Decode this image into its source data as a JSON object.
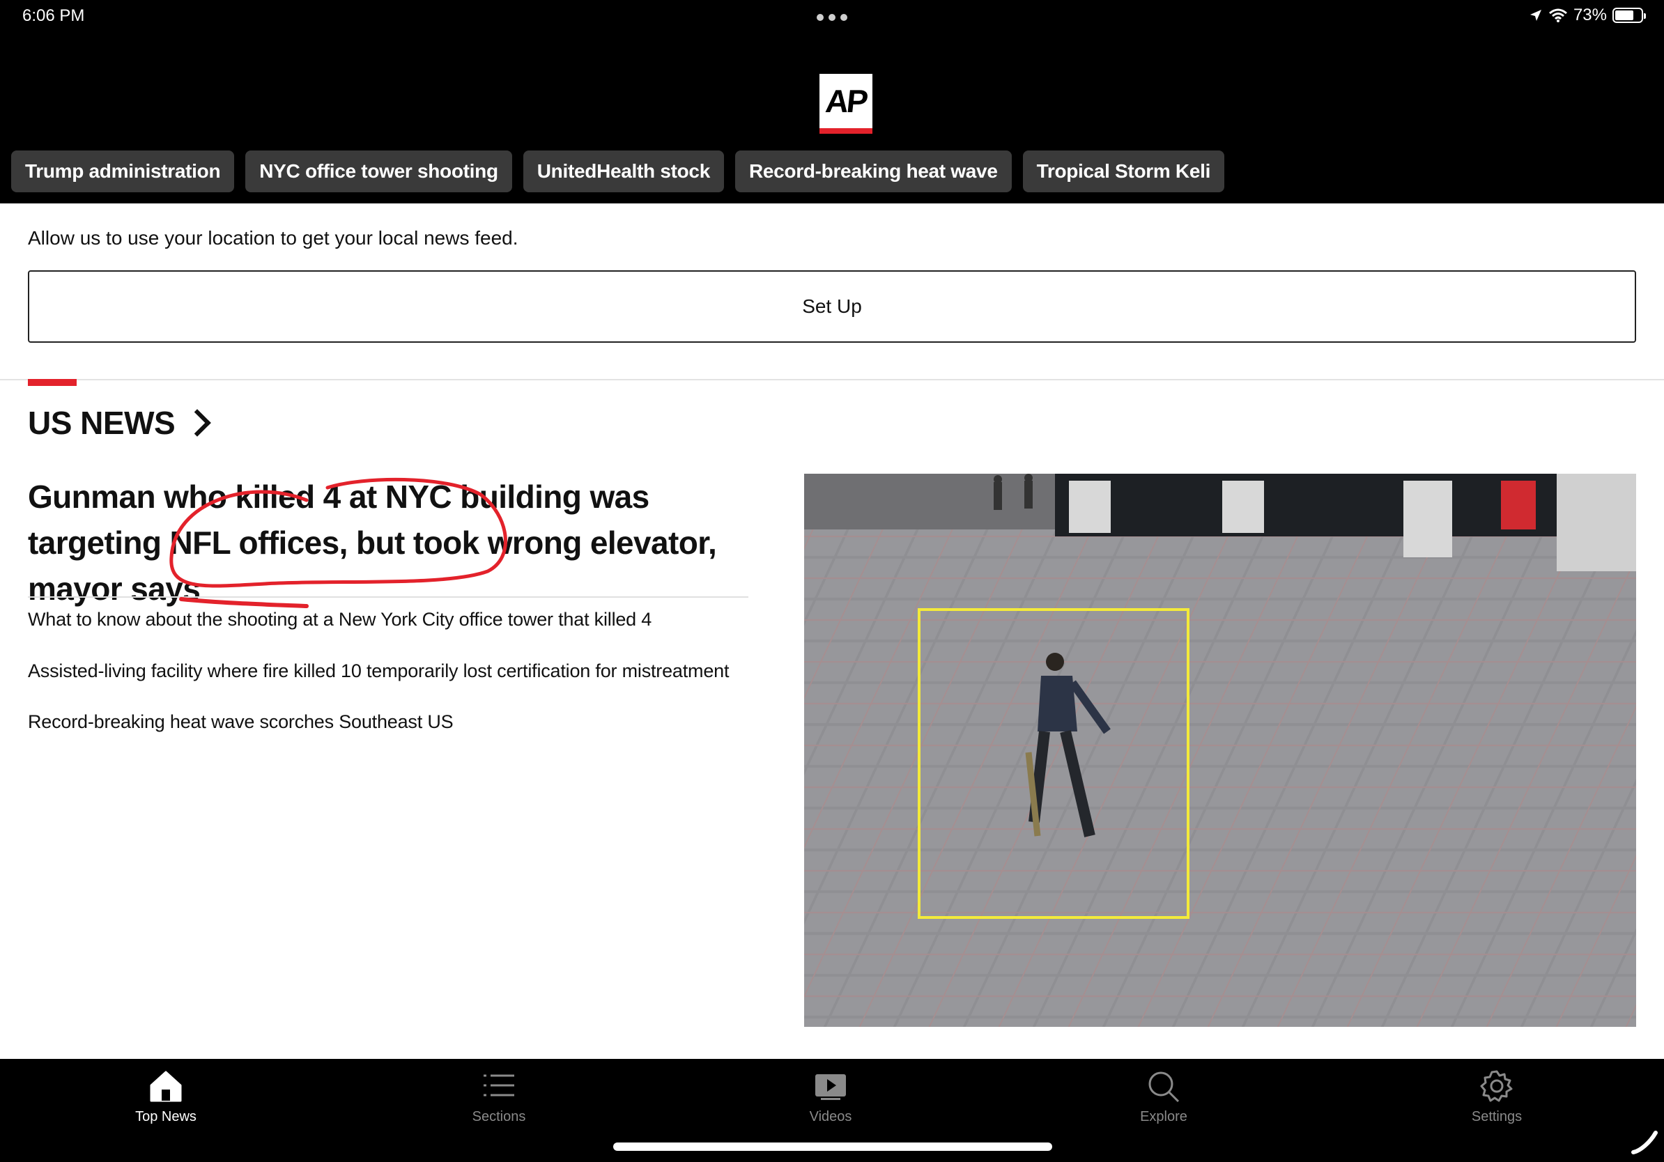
{
  "status": {
    "time": "6:06 PM",
    "battery": "73%"
  },
  "brand": {
    "logo_text": "AP",
    "accent_color": "#e3222b"
  },
  "chips": [
    "Trump administration",
    "NYC office tower shooting",
    "UnitedHealth stock",
    "Record-breaking heat wave",
    "Tropical Storm Keli"
  ],
  "location": {
    "prompt": "Allow us to use your location to get your local news feed.",
    "button": "Set Up"
  },
  "section": {
    "title": "US NEWS"
  },
  "lead": {
    "headline": "Gunman who killed 4 at NYC building was targeting NFL offices, but took wrong elevator, mayor says"
  },
  "stories": [
    "What to know about the shooting at a New York City office tower that killed 4",
    "Assisted-living facility where fire killed 10 temporarily lost certification for mistreatment",
    "Record-breaking heat wave scorches Southeast US"
  ],
  "nav": [
    {
      "label": "Top News",
      "icon": "home-icon",
      "active": true
    },
    {
      "label": "Sections",
      "icon": "list-icon",
      "active": false
    },
    {
      "label": "Videos",
      "icon": "video-icon",
      "active": false
    },
    {
      "label": "Explore",
      "icon": "search-icon",
      "active": false
    },
    {
      "label": "Settings",
      "icon": "gear-icon",
      "active": false
    }
  ]
}
